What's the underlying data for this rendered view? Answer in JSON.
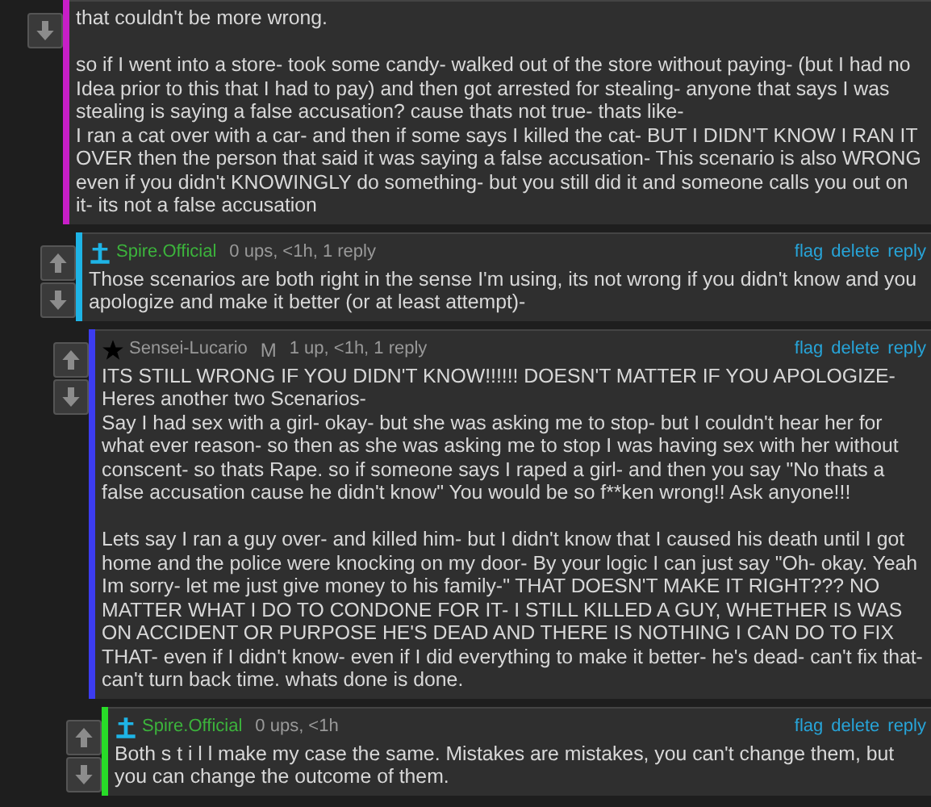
{
  "comments": [
    {
      "color": "#c81ec8",
      "body": [
        "that couldn't be more wrong.",
        "so if I went into a store- took some candy- walked out of the store without paying- (but I had no Idea prior to this that I had to pay) and then got arrested for stealing- anyone that says I was stealing is saying a false accusation? cause thats not true- thats like-\nI ran a cat over with a car- and then if some says I killed the cat- BUT I DIDN'T KNOW I RAN IT OVER then the person that said it was saying a false accusation- This scenario is also WRONG even if you didn't KNOWINGLY do something- but you still did it and someone calls you out on it- its not a false accusation"
      ],
      "children": [
        {
          "color": "#1eb4e6",
          "user": {
            "name": "Spire.Official",
            "kind": "spire"
          },
          "meta": "0 ups, <1h, 1 reply",
          "actions": [
            "flag",
            "delete",
            "reply"
          ],
          "body": [
            "Those scenarios are both right in the sense I'm using, its not wrong if you didn't know and you apologize and make it better (or at least attempt)-"
          ],
          "children": [
            {
              "color": "#3c3cf0",
              "user": {
                "name": "Sensei-Lucario",
                "kind": "star",
                "badge": "M"
              },
              "meta": "1 up, <1h, 1 reply",
              "actions": [
                "flag",
                "delete",
                "reply"
              ],
              "body": [
                "ITS STILL WRONG IF YOU DIDN'T KNOW!!!!!! DOESN'T MATTER IF YOU APOLOGIZE-\nHeres another two Scenarios-\nSay I had sex with a girl- okay- but she was asking me to stop- but I couldn't hear her for what ever reason- so then as she was asking me to stop I was having sex with her without conscent- so thats Rape. so if someone says I raped a girl- and then you say \"No thats a false accusation cause he didn't know\" You would be so f**ken wrong!! Ask anyone!!!",
                "Lets say I ran a guy over- and killed him- but I didn't know that I caused his death until I got home and the police were knocking on my door- By your logic I can just say \"Oh- okay. Yeah Im sorry- let me just give money to his family-\" THAT DOESN'T MAKE IT RIGHT??? NO MATTER WHAT I DO TO CONDONE FOR IT- I STILL KILLED A GUY, WHETHER IS WAS ON ACCIDENT OR PURPOSE HE'S DEAD AND THERE IS NOTHING I CAN DO TO FIX THAT- even if I didn't know- even if I did everything to make it better- he's dead- can't fix that- can't turn back time. whats done is done."
              ],
              "children": [
                {
                  "color": "#28dc28",
                  "user": {
                    "name": "Spire.Official",
                    "kind": "spire"
                  },
                  "meta": "0 ups, <1h",
                  "actions": [
                    "flag",
                    "delete",
                    "reply"
                  ],
                  "body": [
                    "Both s t i l l make my case the same. Mistakes are mistakes, you can't change them, but you can change the outcome of them."
                  ]
                }
              ]
            }
          ]
        }
      ]
    }
  ]
}
